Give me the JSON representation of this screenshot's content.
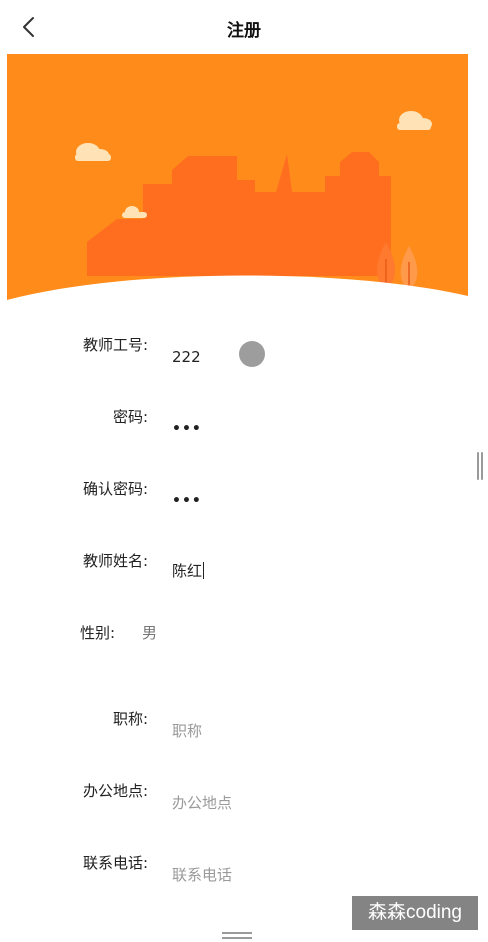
{
  "nav": {
    "title": "注册",
    "back_icon": "chevron-left-icon"
  },
  "banner": {
    "colors": {
      "sky": "#FF8C1A",
      "building": "#FF6E1E",
      "cloud": "#FFE2B5",
      "tree": "#FF7A2E"
    }
  },
  "form": {
    "teacher_id": {
      "label": "教师工号:",
      "value": "222"
    },
    "password": {
      "label": "密码:",
      "value": "•••"
    },
    "confirm_password": {
      "label": "确认密码:",
      "value": "•••"
    },
    "teacher_name": {
      "label": "教师姓名:",
      "value": "陈红"
    },
    "gender": {
      "label": "性别:",
      "value": "男"
    },
    "title": {
      "label": "职称:",
      "placeholder": "职称"
    },
    "office": {
      "label": "办公地点:",
      "placeholder": "办公地点"
    },
    "phone": {
      "label": "联系电话:",
      "placeholder": "联系电话"
    }
  },
  "watermark": {
    "text": "森森coding"
  }
}
